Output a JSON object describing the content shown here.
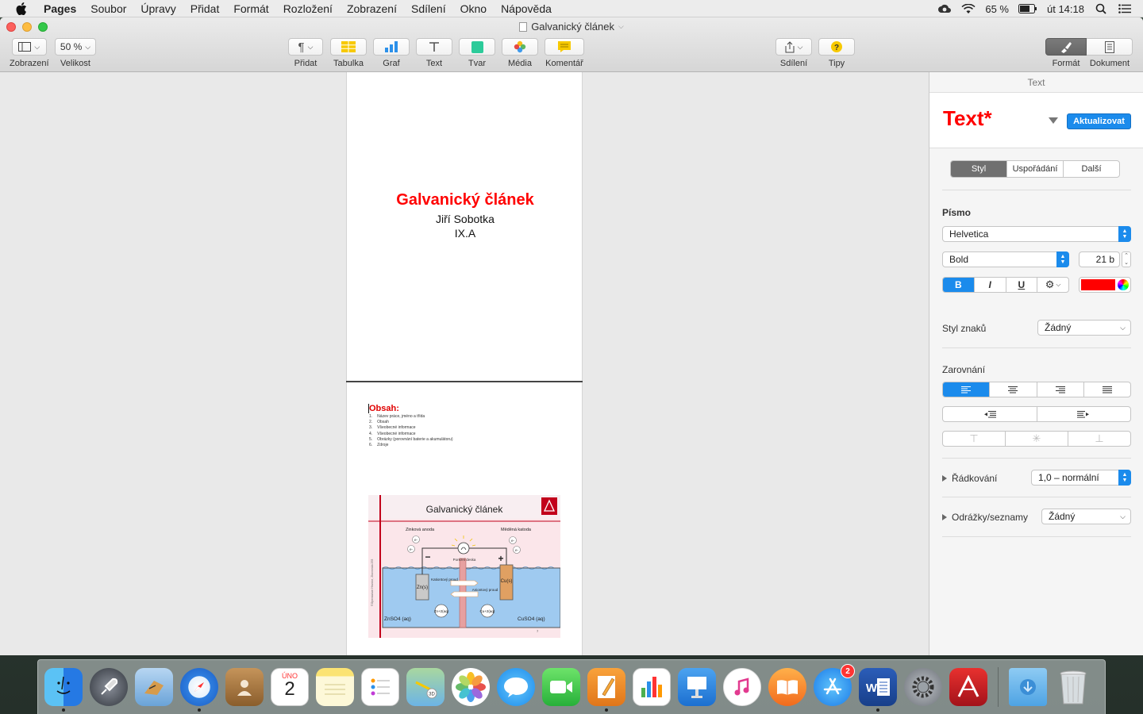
{
  "menubar": {
    "items": [
      "Pages",
      "Soubor",
      "Úpravy",
      "Přidat",
      "Formát",
      "Rozložení",
      "Zobrazení",
      "Sdílení",
      "Okno",
      "Nápověda"
    ],
    "battery": "65 %",
    "clock": "út 14:18"
  },
  "window": {
    "title": "Galvanický článek"
  },
  "toolbar": {
    "view_label": "Zobrazení",
    "zoom_value": "50 %",
    "zoom_label": "Velikost",
    "insert_label": "Přidat",
    "table_label": "Tabulka",
    "chart_label": "Graf",
    "text_label": "Text",
    "shape_label": "Tvar",
    "media_label": "Média",
    "comment_label": "Komentář",
    "share_label": "Sdílení",
    "tips_label": "Tipy",
    "format_label": "Formát",
    "document_label": "Dokument"
  },
  "document": {
    "cover": {
      "title": "Galvanický článek",
      "author": "Jiří Sobotka",
      "class": "IX.A"
    },
    "toc": {
      "title": "Obsah:",
      "items": [
        {
          "num": "1.",
          "text": "Název práce, jméno a třída"
        },
        {
          "num": "2.",
          "text": "Obsah"
        },
        {
          "num": "3.",
          "text": "Všeobecné informace"
        },
        {
          "num": "4.",
          "text": "Všeobecné informace"
        },
        {
          "num": "5.",
          "text": "Obrázky (porovnání baterie a akumulátoru)"
        },
        {
          "num": "6.",
          "text": "Zdroje"
        }
      ]
    },
    "slide": {
      "title": "Galvanický článek",
      "anode": "Zinková anoda",
      "cathode": "Měděná katoda",
      "bridge": "Porézní deska",
      "cation_flow": "Kationtový proud",
      "anion_flow": "Aniontový proud",
      "zn": "Zn(s)",
      "cu": "Cu(s)",
      "zn_ion": "Zn+2(aq)",
      "cu_ion": "Cu+2(aq)",
      "left_solution": "ZnSO4 (aq)",
      "right_solution": "CuSO4 (aq)",
      "electron": "e-",
      "minus": "−",
      "plus": "+",
      "page_num": "7",
      "side_text": "©Gymnázium Hranice, Zborovská 293"
    }
  },
  "sidebar": {
    "header": "Text",
    "style_name": "Text*",
    "update_button": "Aktualizovat",
    "tabs": [
      "Styl",
      "Uspořádání",
      "Další"
    ],
    "font_section": "Písmo",
    "font_family": "Helvetica",
    "font_style": "Bold",
    "font_size": "21 b",
    "bold": "B",
    "italic": "I",
    "underline": "U",
    "char_style_label": "Styl znaků",
    "char_style_value": "Žádný",
    "alignment_section": "Zarovnání",
    "spacing_label": "Řádkování",
    "spacing_value": "1,0 – normální",
    "bullets_label": "Odrážky/seznamy",
    "bullets_value": "Žádný",
    "colors": {
      "accent": "#1b8bec",
      "text_color": "#ff0000"
    }
  },
  "dock": {
    "calendar_month": "ÚNO",
    "calendar_day": "2",
    "appstore_badge": "2"
  }
}
